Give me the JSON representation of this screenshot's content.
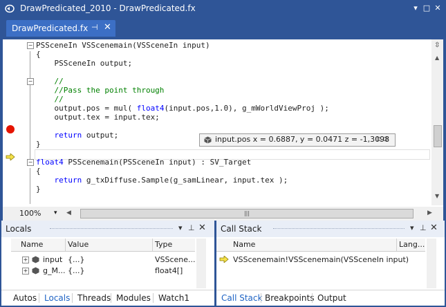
{
  "window": {
    "title": "DrawPredicated_2010 - DrawPredicated.fx",
    "controls": [
      "▾",
      "□",
      "✕"
    ]
  },
  "doc_tab": {
    "label": "DrawPredicated.fx",
    "pin_glyph": "⊣",
    "close_glyph": "✕"
  },
  "code_lines": [
    {
      "text": "PSSceneIn VSScenemain(VSSceneIn input)"
    },
    {
      "text": "{"
    },
    {
      "text": "    PSSceneIn output;"
    },
    {
      "text": "    //"
    },
    {
      "text": "    //Pass the point through"
    },
    {
      "text": "    //"
    },
    {
      "text": "    output.pos = mul( float4(input.pos,1.0), g_mWorldViewProj );"
    },
    {
      "text": "    output.tex = input.tex;"
    },
    {
      "text": "    return output;"
    },
    {
      "text": "}"
    },
    {
      "text": "float4 PSScenemain(PSSceneIn input) : SV_Target"
    },
    {
      "text": "{"
    },
    {
      "text": "    return g_txDiffuse.Sample(g_samLinear, input.tex );"
    },
    {
      "text": "}"
    }
  ],
  "datatip": {
    "text": "input.pos x = 0.6887, y = 0.0471 z = -1,3098"
  },
  "editor_footer": {
    "zoom": "100%"
  },
  "locals": {
    "title": "Locals",
    "columns": [
      "Name",
      "Value",
      "Type"
    ],
    "rows": [
      {
        "name": "input",
        "value": "{...}",
        "type": "VSScene..."
      },
      {
        "name": "g_M...",
        "value": "{...}",
        "type": "float4[]"
      }
    ],
    "tabs": [
      "Autos",
      "Locals",
      "Threads",
      "Modules",
      "Watch1"
    ],
    "active_tab": "Locals"
  },
  "callstack": {
    "title": "Call Stack",
    "columns": [
      "Name",
      "Lang..."
    ],
    "rows": [
      {
        "name": "VSScenemain!VSScenemain(VSSceneIn input)"
      }
    ],
    "tabs": [
      "Call Stack",
      "Breakpoints",
      "Output"
    ],
    "active_tab": "Call Stack"
  },
  "colors": {
    "accent": "#2f5597",
    "tab_active": "#3c6fc5",
    "breakpoint": "#e51400",
    "keyword": "#0000ff",
    "comment": "#008000",
    "active_tab_text": "#1e63c4"
  },
  "icons": [
    "vs-icon",
    "pin-icon",
    "close-icon",
    "breakpoint-icon",
    "current-statement-arrow-icon",
    "object-cube-icon",
    "expand-icon"
  ]
}
